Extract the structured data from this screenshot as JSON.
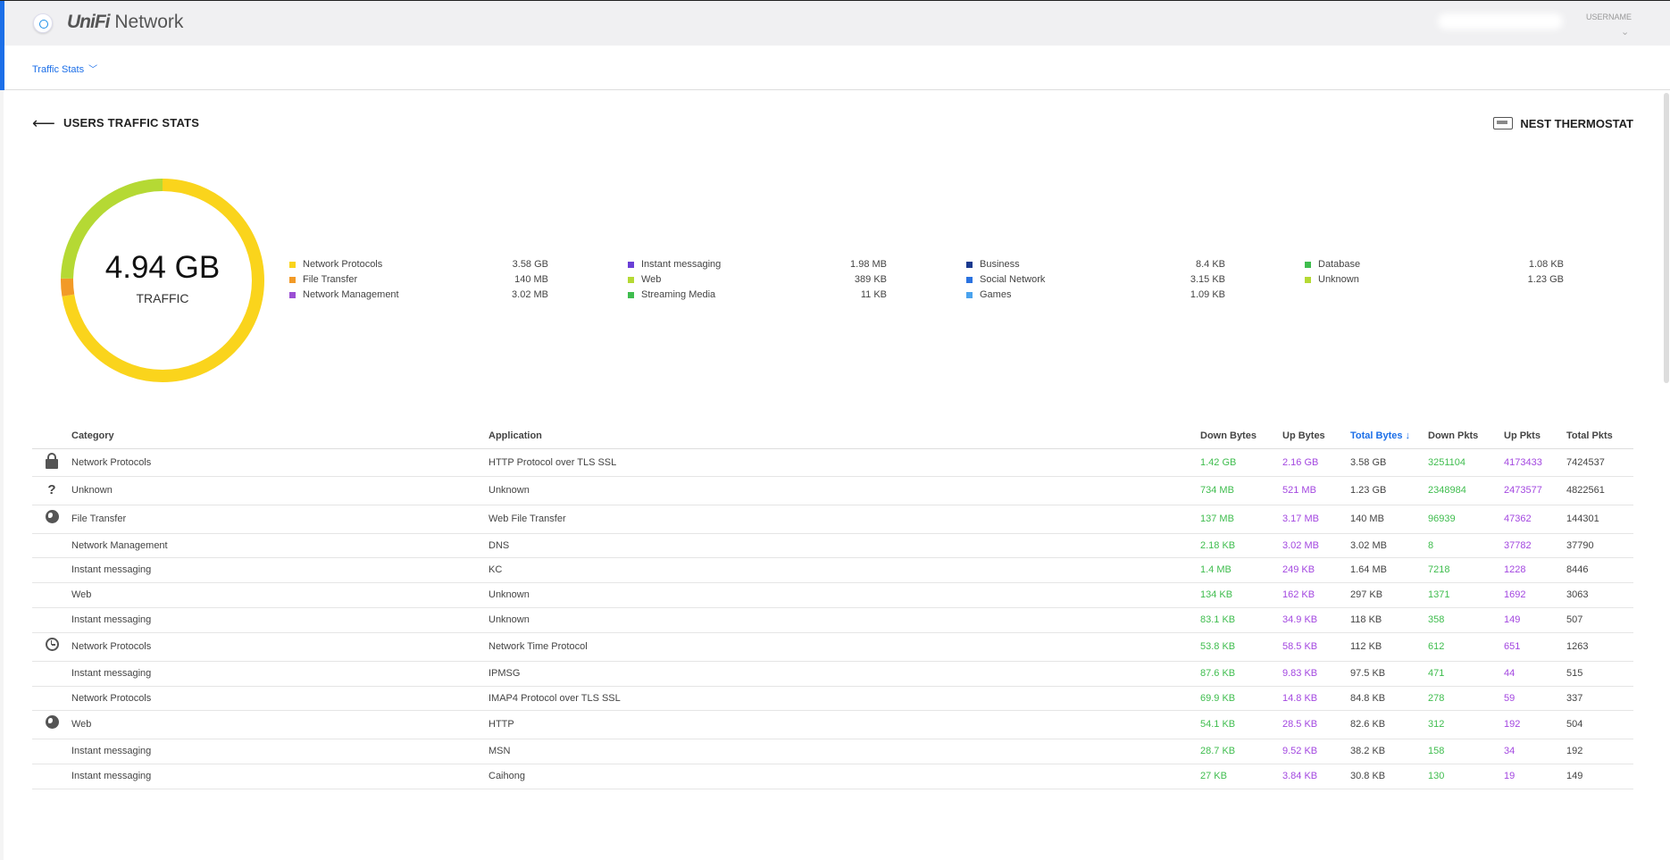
{
  "header": {
    "brand_prefix": "UniFi",
    "brand_name": "Network",
    "username_label": "USERNAME"
  },
  "subnav": {
    "traffic_stats_label": "Traffic Stats"
  },
  "page": {
    "title": "USERS TRAFFIC STATS",
    "device_name": "NEST THERMOSTAT"
  },
  "donut": {
    "total_value": "4.94 GB",
    "total_label": "TRAFFIC",
    "segments": [
      {
        "name": "Network Protocols",
        "fraction": 0.7246,
        "color": "#fad41c"
      },
      {
        "name": "File Transfer",
        "fraction": 0.0283,
        "color": "#f29a27"
      },
      {
        "name": "Unknown",
        "fraction": 0.2471,
        "color": "#b5d934"
      }
    ]
  },
  "legend": [
    [
      {
        "name": "Network Protocols",
        "value": "3.58 GB",
        "color": "#fad41c"
      },
      {
        "name": "File Transfer",
        "value": "140 MB",
        "color": "#f29a27"
      },
      {
        "name": "Network Management",
        "value": "3.02 MB",
        "color": "#9b4fd4"
      }
    ],
    [
      {
        "name": "Instant messaging",
        "value": "1.98 MB",
        "color": "#6a3fd6"
      },
      {
        "name": "Web",
        "value": "389 KB",
        "color": "#b5d934"
      },
      {
        "name": "Streaming Media",
        "value": "11 KB",
        "color": "#3fbd4e"
      }
    ],
    [
      {
        "name": "Business",
        "value": "8.4 KB",
        "color": "#1a3a8f"
      },
      {
        "name": "Social Network",
        "value": "3.15 KB",
        "color": "#2a72e0"
      },
      {
        "name": "Games",
        "value": "1.09 KB",
        "color": "#4aa3ee"
      }
    ],
    [
      {
        "name": "Database",
        "value": "1.08 KB",
        "color": "#3fbd4e"
      },
      {
        "name": "Unknown",
        "value": "1.23 GB",
        "color": "#b5d934"
      }
    ]
  ],
  "table": {
    "headers": {
      "category": "Category",
      "application": "Application",
      "down_bytes": "Down Bytes",
      "up_bytes": "Up Bytes",
      "total_bytes": "Total Bytes",
      "sort_arrow": "↓",
      "down_pkts": "Down Pkts",
      "up_pkts": "Up Pkts",
      "total_pkts": "Total Pkts"
    },
    "rows": [
      {
        "icon": "lock-icon",
        "category": "Network Protocols",
        "application": "HTTP Protocol over TLS SSL",
        "down_bytes": "1.42 GB",
        "up_bytes": "2.16 GB",
        "total_bytes": "3.58 GB",
        "down_pkts": "3251104",
        "up_pkts": "4173433",
        "total_pkts": "7424537"
      },
      {
        "icon": "question-icon",
        "category": "Unknown",
        "application": "Unknown",
        "down_bytes": "734 MB",
        "up_bytes": "521 MB",
        "total_bytes": "1.23 GB",
        "down_pkts": "2348984",
        "up_pkts": "2473577",
        "total_pkts": "4822561"
      },
      {
        "icon": "globe-icon",
        "category": "File Transfer",
        "application": "Web File Transfer",
        "down_bytes": "137 MB",
        "up_bytes": "3.17 MB",
        "total_bytes": "140 MB",
        "down_pkts": "96939",
        "up_pkts": "47362",
        "total_pkts": "144301"
      },
      {
        "icon": "",
        "category": "Network Management",
        "application": "DNS",
        "down_bytes": "2.18 KB",
        "up_bytes": "3.02 MB",
        "total_bytes": "3.02 MB",
        "down_pkts": "8",
        "up_pkts": "37782",
        "total_pkts": "37790"
      },
      {
        "icon": "",
        "category": "Instant messaging",
        "application": "KC",
        "down_bytes": "1.4 MB",
        "up_bytes": "249 KB",
        "total_bytes": "1.64 MB",
        "down_pkts": "7218",
        "up_pkts": "1228",
        "total_pkts": "8446"
      },
      {
        "icon": "",
        "category": "Web",
        "application": "Unknown",
        "down_bytes": "134 KB",
        "up_bytes": "162 KB",
        "total_bytes": "297 KB",
        "down_pkts": "1371",
        "up_pkts": "1692",
        "total_pkts": "3063"
      },
      {
        "icon": "",
        "category": "Instant messaging",
        "application": "Unknown",
        "down_bytes": "83.1 KB",
        "up_bytes": "34.9 KB",
        "total_bytes": "118 KB",
        "down_pkts": "358",
        "up_pkts": "149",
        "total_pkts": "507"
      },
      {
        "icon": "clock-icon",
        "category": "Network Protocols",
        "application": "Network Time Protocol",
        "down_bytes": "53.8 KB",
        "up_bytes": "58.5 KB",
        "total_bytes": "112 KB",
        "down_pkts": "612",
        "up_pkts": "651",
        "total_pkts": "1263"
      },
      {
        "icon": "",
        "category": "Instant messaging",
        "application": "IPMSG",
        "down_bytes": "87.6 KB",
        "up_bytes": "9.83 KB",
        "total_bytes": "97.5 KB",
        "down_pkts": "471",
        "up_pkts": "44",
        "total_pkts": "515"
      },
      {
        "icon": "",
        "category": "Network Protocols",
        "application": "IMAP4 Protocol over TLS SSL",
        "down_bytes": "69.9 KB",
        "up_bytes": "14.8 KB",
        "total_bytes": "84.8 KB",
        "down_pkts": "278",
        "up_pkts": "59",
        "total_pkts": "337"
      },
      {
        "icon": "globe-icon",
        "category": "Web",
        "application": "HTTP",
        "down_bytes": "54.1 KB",
        "up_bytes": "28.5 KB",
        "total_bytes": "82.6 KB",
        "down_pkts": "312",
        "up_pkts": "192",
        "total_pkts": "504"
      },
      {
        "icon": "",
        "category": "Instant messaging",
        "application": "MSN",
        "down_bytes": "28.7 KB",
        "up_bytes": "9.52 KB",
        "total_bytes": "38.2 KB",
        "down_pkts": "158",
        "up_pkts": "34",
        "total_pkts": "192"
      },
      {
        "icon": "",
        "category": "Instant messaging",
        "application": "Caihong",
        "down_bytes": "27 KB",
        "up_bytes": "3.84 KB",
        "total_bytes": "30.8 KB",
        "down_pkts": "130",
        "up_pkts": "19",
        "total_pkts": "149"
      }
    ]
  }
}
